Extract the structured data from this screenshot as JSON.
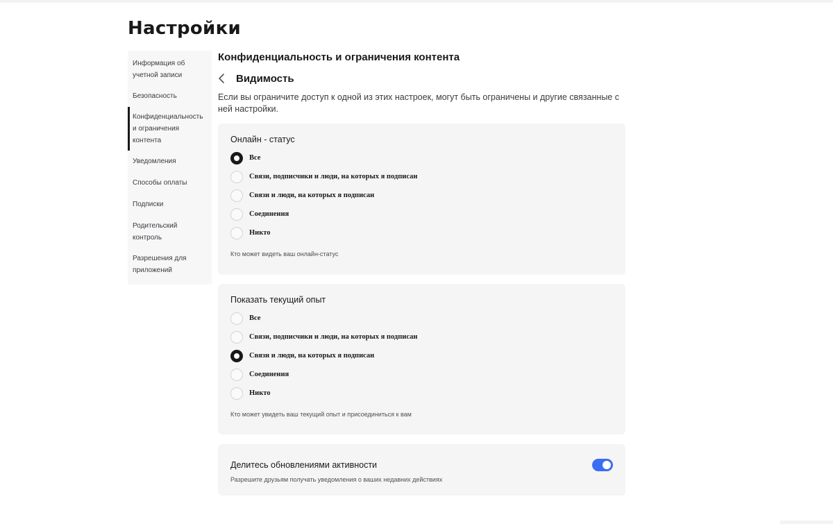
{
  "page": {
    "title": "Настройки"
  },
  "sidebar": {
    "items": [
      {
        "label": "Информация об учетной записи",
        "active": false
      },
      {
        "label": "Безопасность",
        "active": false
      },
      {
        "label": "Конфиденциальность и ограничения контента",
        "active": true
      },
      {
        "label": "Уведомления",
        "active": false
      },
      {
        "label": "Способы оплаты",
        "active": false
      },
      {
        "label": "Подписки",
        "active": false
      },
      {
        "label": "Родительский контроль",
        "active": false
      },
      {
        "label": "Разрешения для приложений",
        "active": false
      }
    ]
  },
  "main": {
    "heading": "Конфиденциальность и ограничения контента",
    "subheading": "Видимость",
    "info": "Если вы ограничите доступ к одной из этих настроек, могут быть ограничены и другие связанные с ней настройки."
  },
  "online_status": {
    "title": "Онлайн - статус",
    "options": [
      "Все",
      "Связи, подписчики и люди, на которых я подписан",
      "Связи и люди, на которых я подписан",
      "Соединения",
      "Никто"
    ],
    "selected": "Все",
    "hint": "Кто может видеть ваш онлайн-статус"
  },
  "current_experience": {
    "title": "Показать текущий опыт",
    "options": [
      "Все",
      "Связи, подписчики и люди, на которых я подписан",
      "Связи и люди, на которых я подписан",
      "Соединения",
      "Никто"
    ],
    "selected": "Связи и люди, на которых я подписан",
    "hint": "Кто может увидеть ваш текущий опыт и присоединиться к вам"
  },
  "activity_updates": {
    "title": "Делитесь обновлениями активности",
    "hint": "Разрешите друзьям получать уведомления о ваших недавних действиях",
    "enabled": true
  },
  "colors": {
    "accent": "#3b6cf4",
    "card_bg": "#f5f5f6",
    "sidebar_bg": "#f7f7f8",
    "text": "#191919"
  },
  "icons": {
    "back": "chevron-left-icon"
  }
}
